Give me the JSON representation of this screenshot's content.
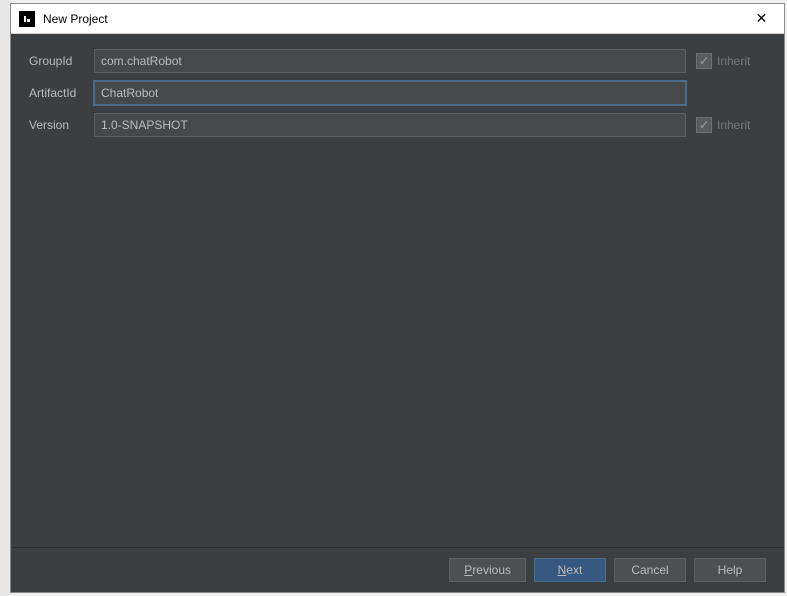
{
  "window": {
    "title": "New Project"
  },
  "form": {
    "groupId": {
      "label": "GroupId",
      "value": "com.chatRobot",
      "inherit_label": "Inherit"
    },
    "artifactId": {
      "label": "ArtifactId",
      "value": "ChatRobot"
    },
    "version": {
      "label": "Version",
      "value": "1.0-SNAPSHOT",
      "inherit_label": "Inherit"
    }
  },
  "buttons": {
    "previous": "Previous",
    "next": "Next",
    "cancel": "Cancel",
    "help": "Help"
  }
}
